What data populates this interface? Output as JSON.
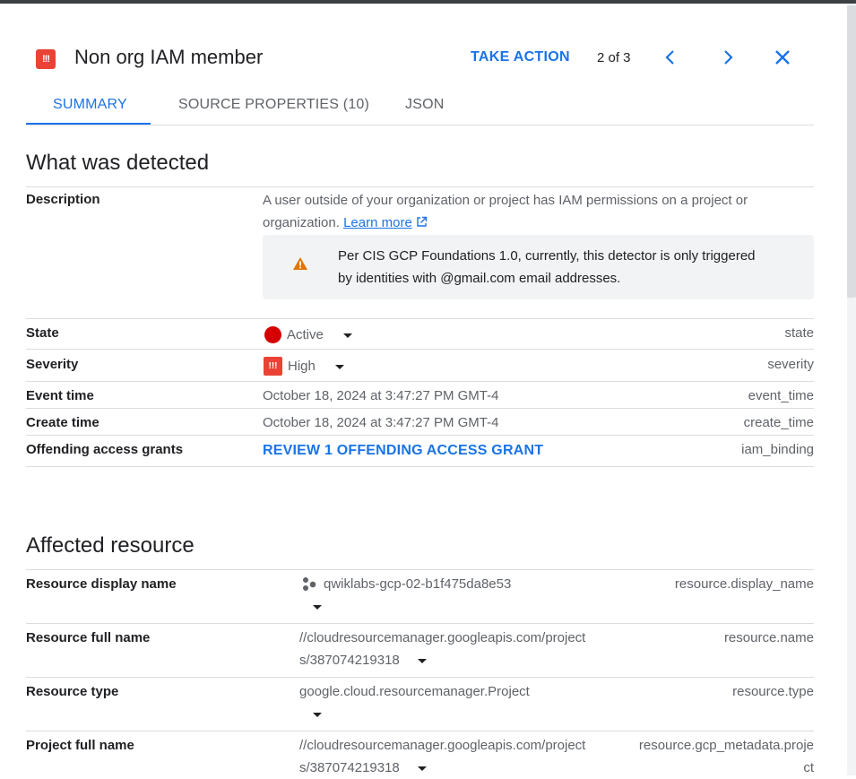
{
  "header": {
    "title": "Non org IAM member",
    "severity_icon_text": "!!!",
    "take_action": "TAKE ACTION",
    "pager": "2 of 3",
    "icons": {
      "prev": "chevron-left-icon",
      "next": "chevron-right-icon",
      "close": "close-icon"
    }
  },
  "tabs": [
    {
      "label": "SUMMARY",
      "active": true
    },
    {
      "label": "SOURCE PROPERTIES (10)",
      "active": false
    },
    {
      "label": "JSON",
      "active": false
    }
  ],
  "detected": {
    "title": "What was detected",
    "description": {
      "label": "Description",
      "text_line1": "A user outside of your organization or project has IAM permissions on a project or",
      "text_line2": "organization.",
      "learn_more": "Learn more",
      "warning_line1": "Per CIS GCP Foundations 1.0, currently, this detector is only triggered",
      "warning_line2": "by identities with @gmail.com email addresses."
    },
    "state": {
      "label": "State",
      "value": "Active",
      "key": "state",
      "color": "#d50000"
    },
    "severity": {
      "label": "Severity",
      "value": "High",
      "key": "severity",
      "color": "#ea4335"
    },
    "event_time": {
      "label": "Event time",
      "value": "October 18, 2024 at 3:47:27 PM GMT-4",
      "key": "event_time"
    },
    "create_time": {
      "label": "Create time",
      "value": "October 18, 2024 at 3:47:27 PM GMT-4",
      "key": "create_time"
    },
    "grants": {
      "label": "Offending access grants",
      "value": "REVIEW 1 OFFENDING ACCESS GRANT",
      "key": "iam_binding"
    }
  },
  "affected": {
    "title": "Affected resource",
    "display_name": {
      "label": "Resource display name",
      "value": "qwiklabs-gcp-02-b1f475da8e53",
      "key": "resource.display_name"
    },
    "full_name": {
      "label": "Resource full name",
      "value_line1": "//cloudresourcemanager.googleapis.com/project",
      "value_line2": "s/387074219318",
      "key": "resource.name"
    },
    "type": {
      "label": "Resource type",
      "value": "google.cloud.resourcemanager.Project",
      "key": "resource.type"
    },
    "project_full_name": {
      "label": "Project full name",
      "value_line1": "//cloudresourcemanager.googleapis.com/project",
      "value_line2": "s/387074219318",
      "key_line1": "resource.gcp_metadata.proje",
      "key_line2": "ct"
    }
  },
  "colors": {
    "accent": "#1a73e8",
    "severity_red": "#ea4335",
    "warning_orange": "#e37400"
  }
}
